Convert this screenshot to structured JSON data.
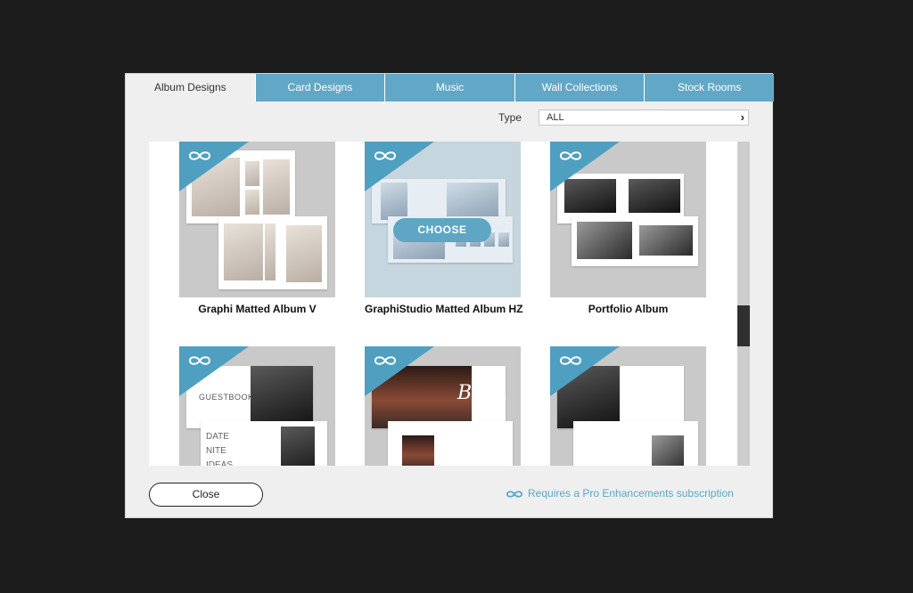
{
  "tabs": [
    "Album Designs",
    "Card Designs",
    "Music",
    "Wall Collections",
    "Stock Rooms"
  ],
  "filter": {
    "label": "Type",
    "value": "ALL"
  },
  "templates": [
    {
      "name": "Graphi Matted Album V"
    },
    {
      "name": "GraphiStudio Matted Album HZ"
    },
    {
      "name": "Portfolio Album"
    },
    {
      "name": "",
      "guestbook_title": "GUESTBOOK",
      "list_lines": [
        "DATE",
        "NITE",
        "IDEAS"
      ]
    },
    {
      "name": "",
      "script_word": "Book"
    },
    {
      "name": ""
    }
  ],
  "choose_label": "CHOOSE",
  "close_label": "Close",
  "pro_note": "Requires a Pro Enhancements subscription",
  "colors": {
    "accent": "#62a8c6",
    "badge": "#4f9fc0",
    "backdrop": "#1c1c1c"
  }
}
